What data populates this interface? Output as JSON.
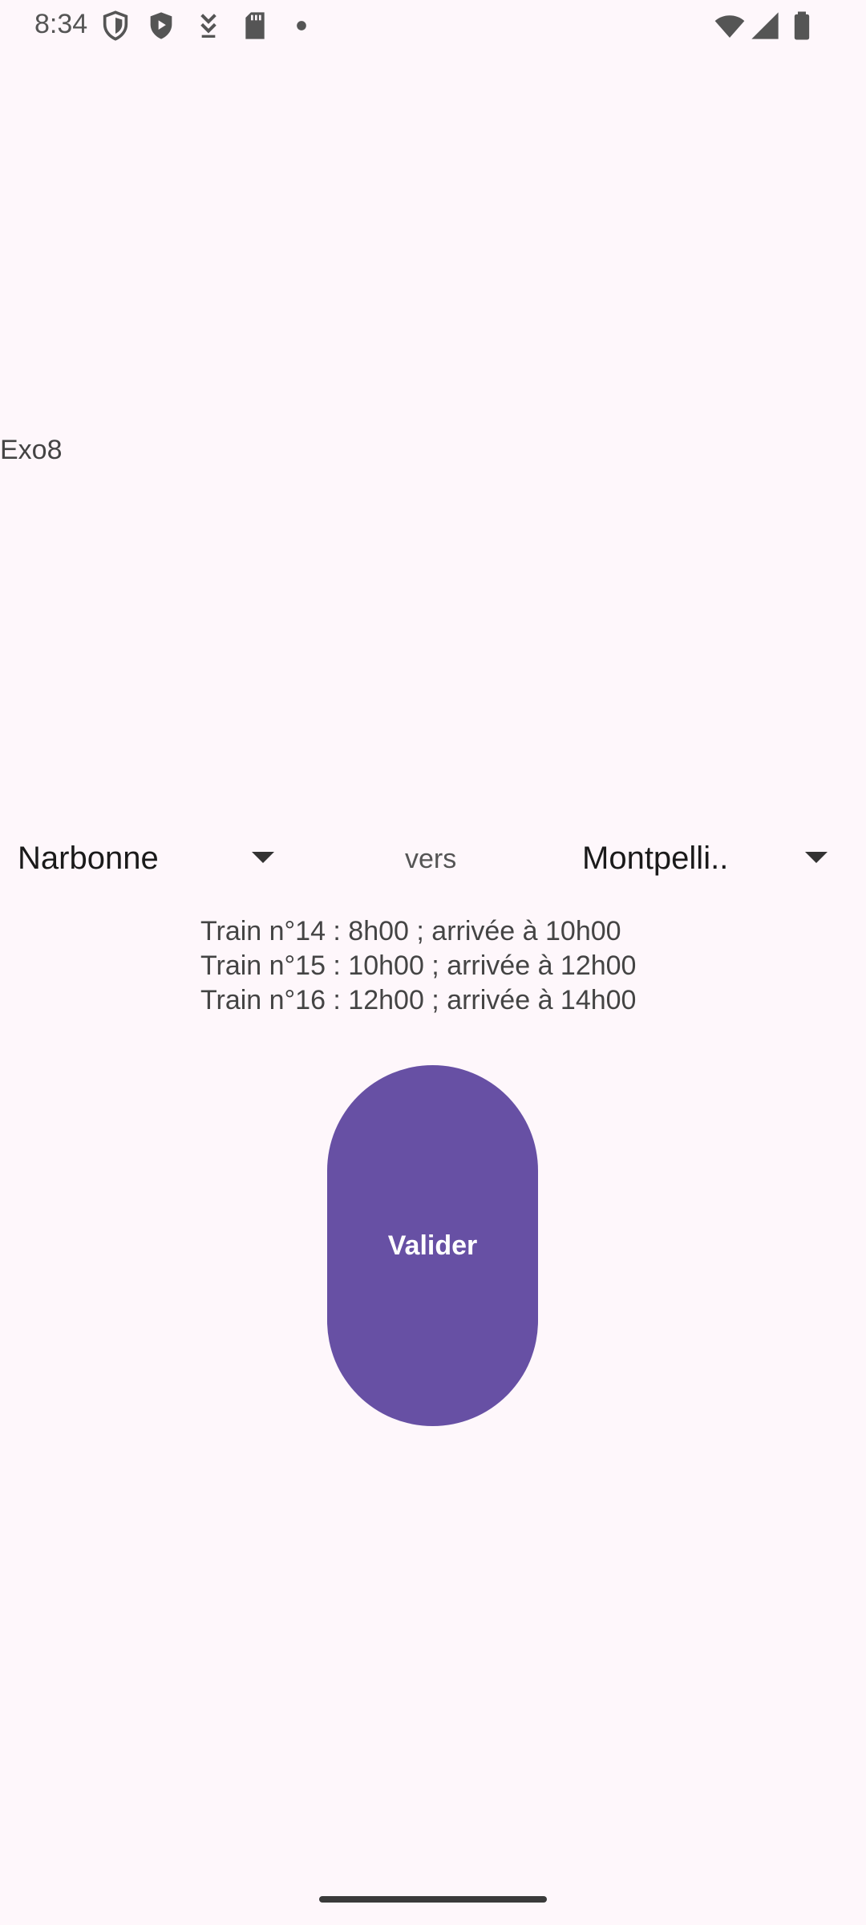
{
  "status_bar": {
    "time": "8:34",
    "icons_left": [
      "shield-icon",
      "play-protect-icon",
      "download-icon",
      "sd-card-icon",
      "notification-dot-icon"
    ],
    "icons_right": [
      "wifi-icon",
      "signal-icon",
      "battery-icon"
    ]
  },
  "app": {
    "title": "Exo8"
  },
  "route": {
    "from_value": "Narbonne",
    "connector": "vers",
    "to_value": "Montpelli.."
  },
  "trains": [
    "Train n°14 : 8h00 ; arrivée à 10h00",
    "Train n°15 : 10h00 ; arrivée à 12h00",
    "Train n°16 : 12h00 ; arrivée à 14h00"
  ],
  "actions": {
    "validate_label": "Valider"
  },
  "colors": {
    "background": "#FEF7FB",
    "button": "#6750A4",
    "button_text": "#FFFFFF"
  }
}
